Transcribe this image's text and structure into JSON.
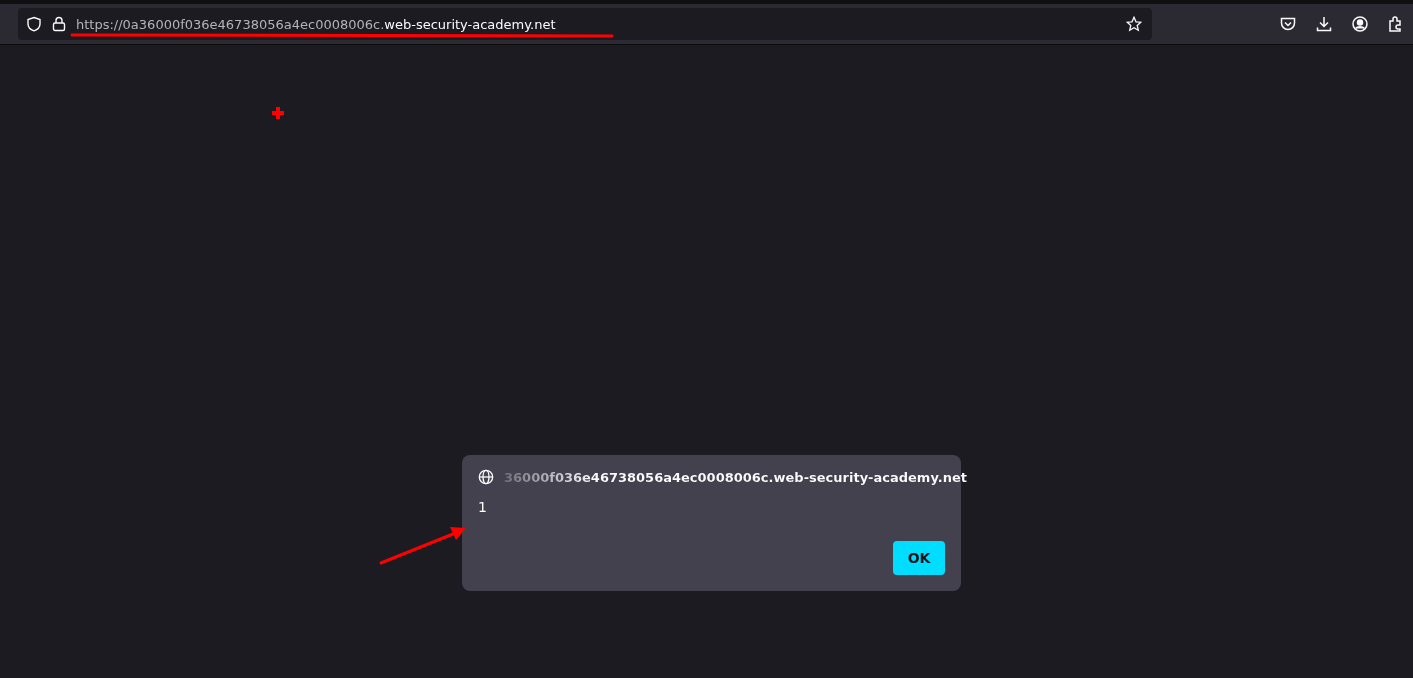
{
  "address_bar": {
    "url_dim": "https://0a36000f036e46738056a4ec0008006c.",
    "url_domain": "web-security-academy.net"
  },
  "dialog": {
    "origin": "36000f036e46738056a4ec0008006c.web-security-academy.net",
    "message": "1",
    "button": "OK"
  }
}
